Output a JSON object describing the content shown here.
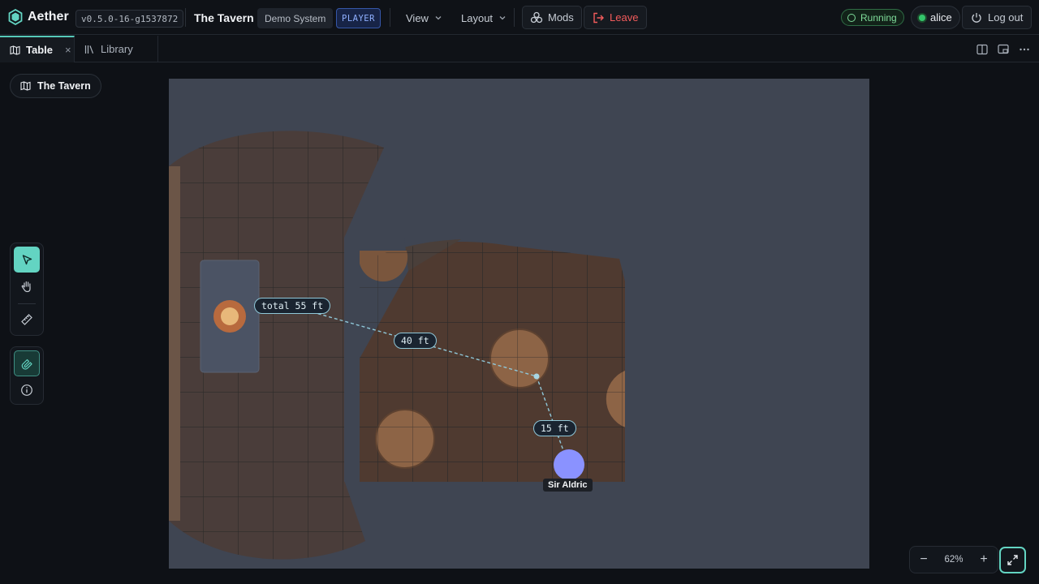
{
  "app": {
    "name": "Aether",
    "version": "v0.5.0-16-g1537872",
    "room_title": "The Tavern",
    "system_badge": "Demo System",
    "role_badge": "PLAYER"
  },
  "menus": {
    "view": "View",
    "layout": "Layout",
    "mods": "Mods",
    "leave": "Leave"
  },
  "session": {
    "status": "Running",
    "user": "alice",
    "logout": "Log out"
  },
  "tabs": [
    {
      "label": "Table",
      "active": true,
      "closable": true,
      "icon": "map-icon"
    },
    {
      "label": "Library",
      "active": false,
      "closable": false,
      "icon": "library-icon"
    }
  ],
  "tab_close_glyph": "×",
  "tab_tools": [
    "split-view-icon",
    "popout-icon",
    "more-icon"
  ],
  "scene": {
    "name": "The Tavern"
  },
  "measure": {
    "total": "total 55 ft",
    "segment_1": "40 ft",
    "segment_2": "15 ft"
  },
  "token": {
    "name": "Sir Aldric",
    "color": "#8a92ff"
  },
  "tools": {
    "select_active": true,
    "snap_enabled": true,
    "items": [
      "select-icon",
      "pan-hand-icon",
      "ruler-icon",
      "snap-magnet-icon",
      "info-icon"
    ]
  },
  "zoom": {
    "level": "62%",
    "minus": "−",
    "plus": "+"
  },
  "colors": {
    "accent": "#63d4c2",
    "danger": "#f25b5b",
    "running": "#7fdc9a",
    "map_background": "#3f4552",
    "room_floor": "#4f3a30",
    "measure_line": "#8fc7d8"
  }
}
